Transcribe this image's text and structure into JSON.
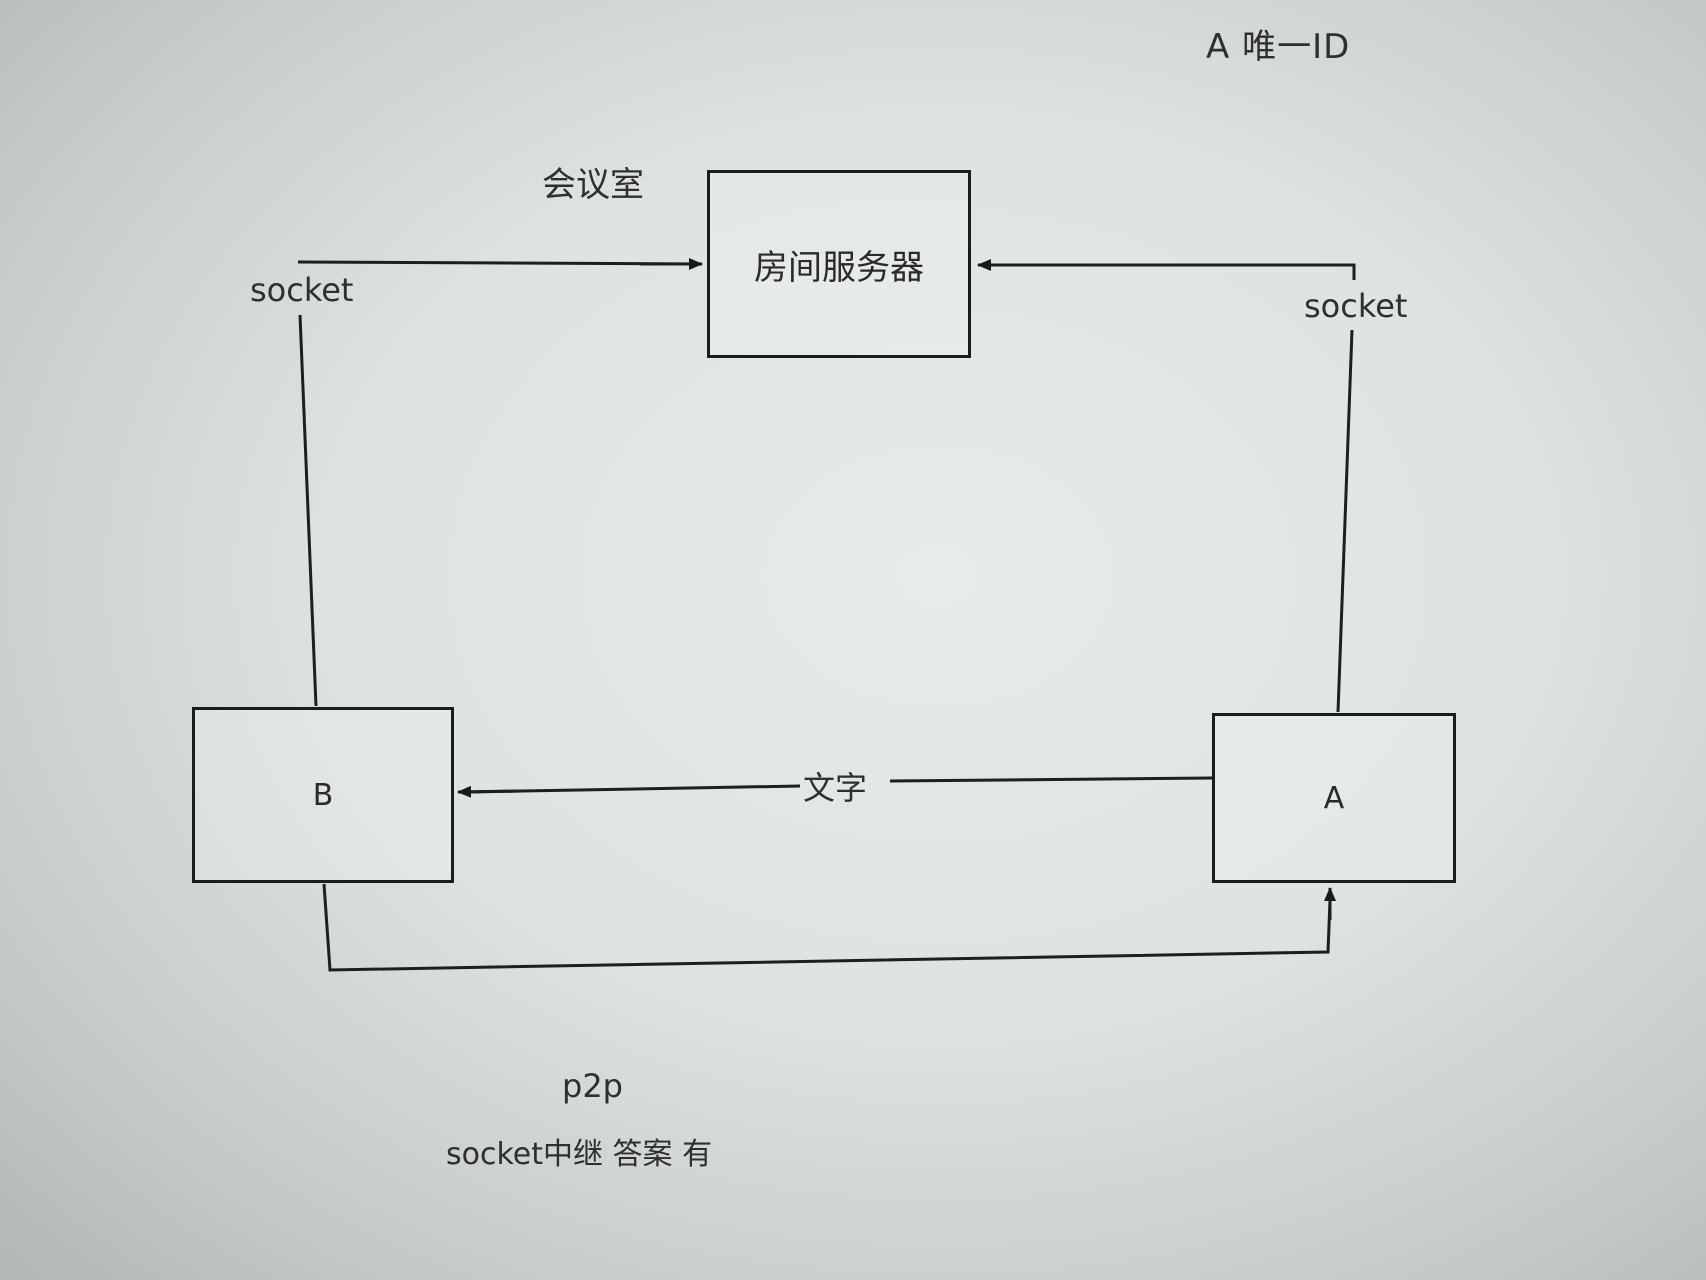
{
  "header": {
    "top_right_note": "A 唯一ID"
  },
  "diagram": {
    "meeting_room_label": "会议室",
    "nodes": {
      "server": "房间服务器",
      "b": "B",
      "a": "A"
    },
    "edges": {
      "b_to_server_label": "socket",
      "a_to_server_label": "socket",
      "a_to_b_label": "文字"
    }
  },
  "notes": {
    "p2p": "p2p",
    "relay": "socket中继  答案 有"
  }
}
